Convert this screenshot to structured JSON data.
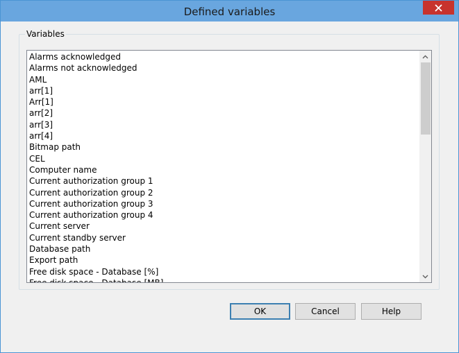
{
  "window": {
    "title": "Defined variables",
    "accent": "#69a6df",
    "close_color": "#c7332d",
    "icons": {
      "close": "close-icon",
      "up": "chevron-up-icon",
      "down": "chevron-down-icon"
    }
  },
  "variables": {
    "label": "Variables",
    "items": [
      "Alarms acknowledged",
      "Alarms not acknowledged",
      "AML",
      "arr[1]",
      "Arr[1]",
      "arr[2]",
      "arr[3]",
      "arr[4]",
      "Bitmap path",
      "CEL",
      "Computer name",
      "Current authorization group 1",
      "Current authorization group 2",
      "Current authorization group 3",
      "Current authorization group 4",
      "Current server",
      "Current standby server",
      "Database path",
      "Export path",
      "Free disk space - Database [%]",
      "Free disk space - Database [MB]"
    ]
  },
  "buttons": {
    "ok": "OK",
    "cancel": "Cancel",
    "help": "Help"
  }
}
